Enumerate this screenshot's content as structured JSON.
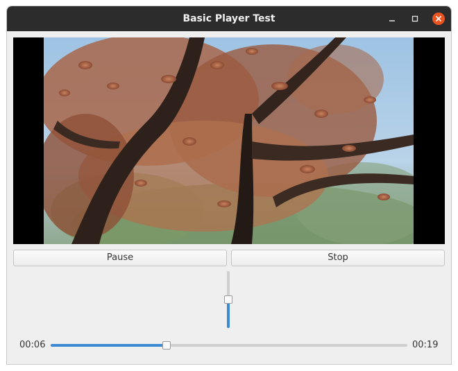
{
  "window": {
    "title": "Basic Player Test"
  },
  "titlebar_buttons": [
    {
      "name": "minimize",
      "icon": "minimize-icon"
    },
    {
      "name": "maximize",
      "icon": "maximize-icon"
    },
    {
      "name": "close",
      "icon": "close-icon",
      "color": "#e95420"
    }
  ],
  "video": {
    "content": "video-frame-tree-foliage"
  },
  "controls": {
    "pause_label": "Pause",
    "stop_label": "Stop"
  },
  "volume": {
    "level": 0.5
  },
  "seek": {
    "current_time": "00:06",
    "total_time": "00:19",
    "progress": 0.325
  },
  "colors": {
    "accent": "#3b8bd4",
    "titlebar": "#2c2c2c",
    "close": "#e95420"
  }
}
